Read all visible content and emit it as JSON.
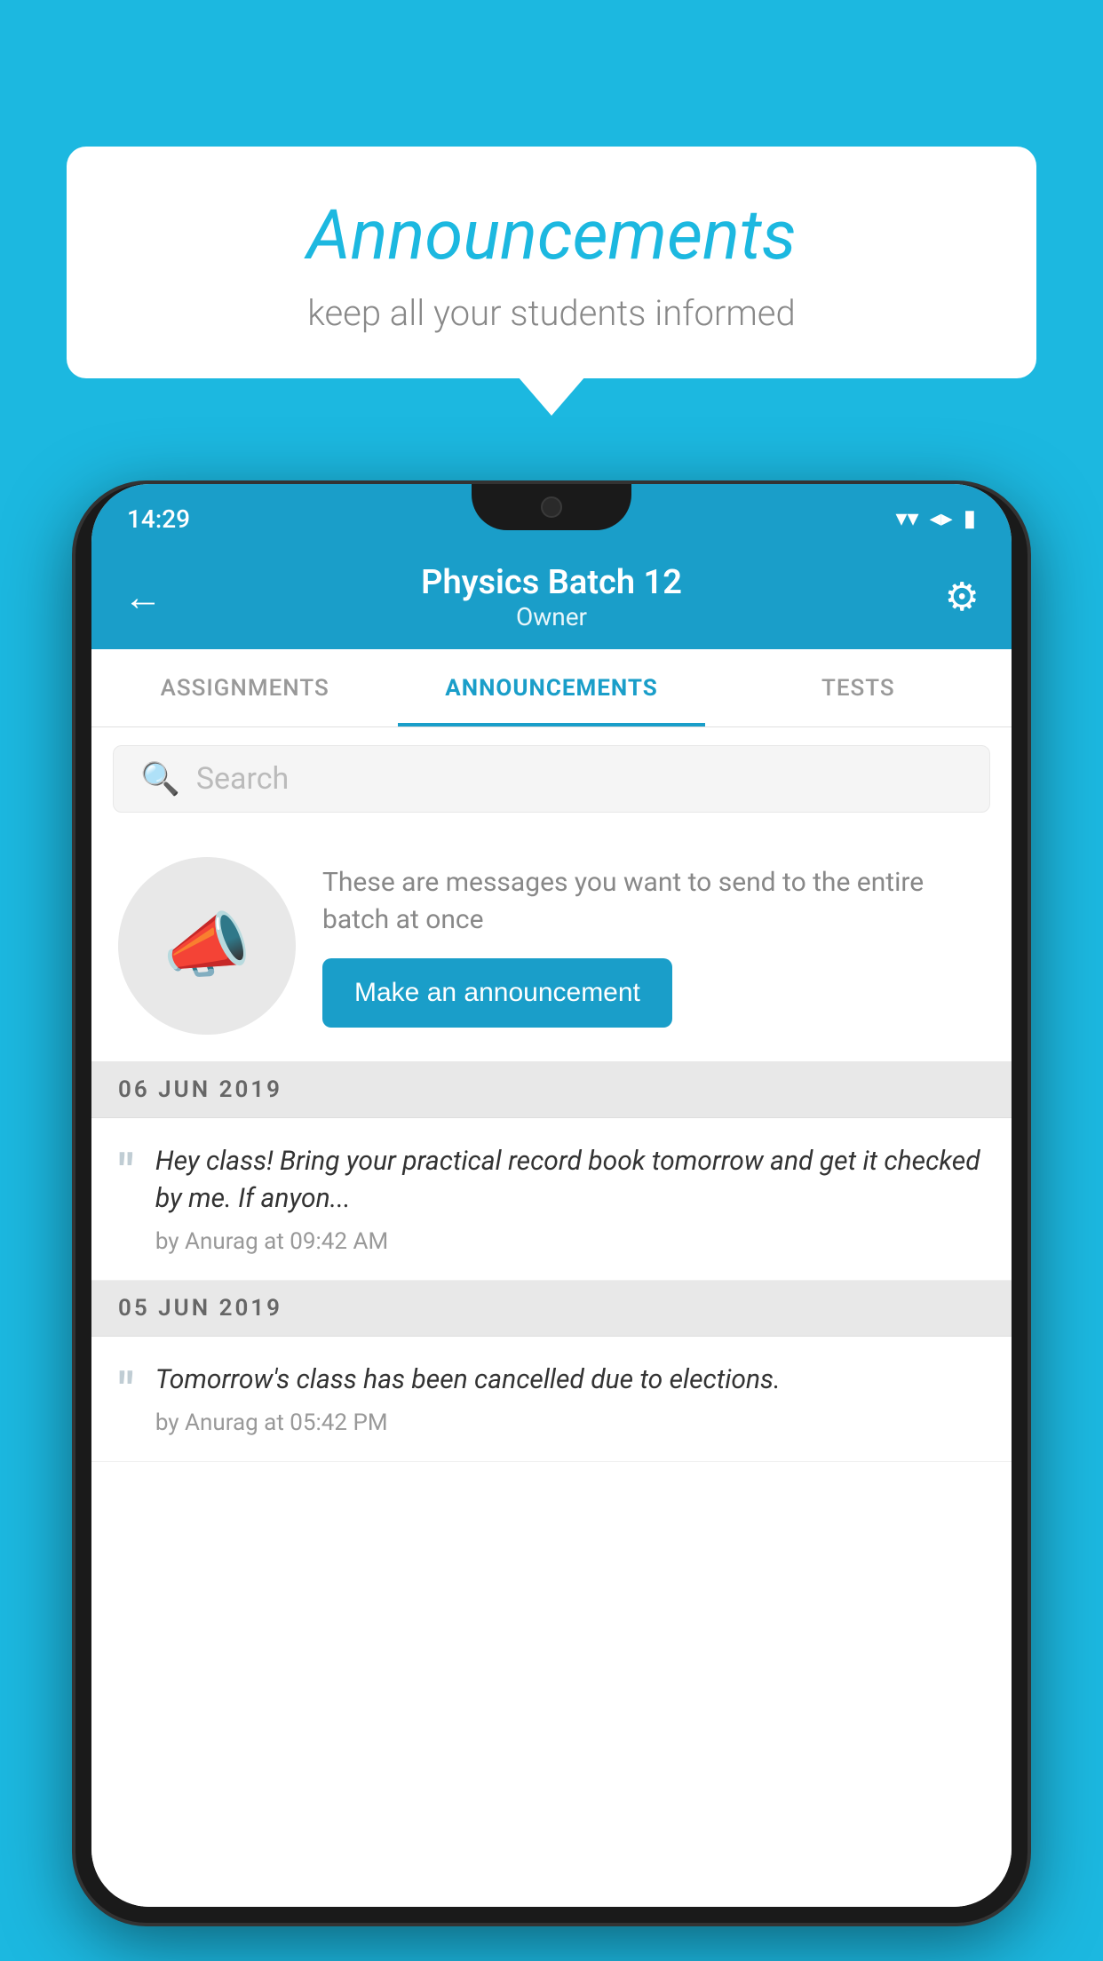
{
  "background_color": "#1cb8e0",
  "speech_bubble": {
    "title": "Announcements",
    "subtitle": "keep all your students informed"
  },
  "status_bar": {
    "time": "14:29",
    "wifi": "▼",
    "signal": "▲",
    "battery": "▮"
  },
  "app_bar": {
    "title": "Physics Batch 12",
    "subtitle": "Owner",
    "back_label": "←",
    "settings_label": "⚙"
  },
  "tabs": [
    {
      "label": "ASSIGNMENTS",
      "active": false
    },
    {
      "label": "ANNOUNCEMENTS",
      "active": true
    },
    {
      "label": "TESTS",
      "active": false
    }
  ],
  "search": {
    "placeholder": "Search"
  },
  "promo": {
    "description": "These are messages you want to send to the entire batch at once",
    "button_label": "Make an announcement"
  },
  "announcements": [
    {
      "date": "06  JUN  2019",
      "text": "Hey class! Bring your practical record book tomorrow and get it checked by me. If anyon...",
      "meta": "by Anurag at 09:42 AM"
    },
    {
      "date": "05  JUN  2019",
      "text": "Tomorrow's class has been cancelled due to elections.",
      "meta": "by Anurag at 05:42 PM"
    }
  ]
}
